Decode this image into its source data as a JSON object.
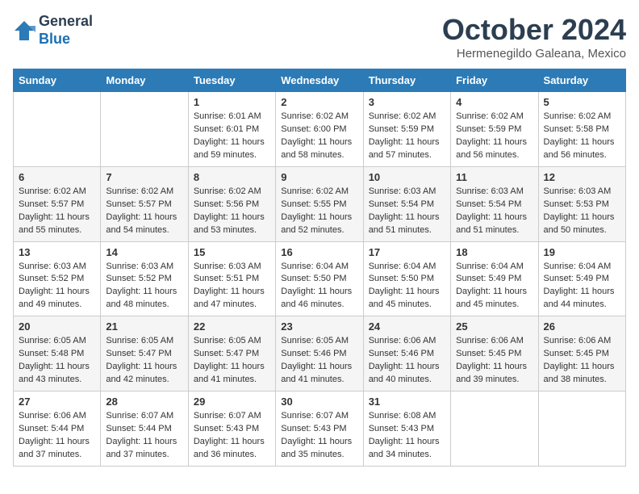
{
  "header": {
    "logo_line1": "General",
    "logo_line2": "Blue",
    "month_title": "October 2024",
    "location": "Hermenegildo Galeana, Mexico"
  },
  "weekdays": [
    "Sunday",
    "Monday",
    "Tuesday",
    "Wednesday",
    "Thursday",
    "Friday",
    "Saturday"
  ],
  "weeks": [
    [
      {
        "day": "",
        "content": ""
      },
      {
        "day": "",
        "content": ""
      },
      {
        "day": "1",
        "content": "Sunrise: 6:01 AM\nSunset: 6:01 PM\nDaylight: 11 hours and 59 minutes."
      },
      {
        "day": "2",
        "content": "Sunrise: 6:02 AM\nSunset: 6:00 PM\nDaylight: 11 hours and 58 minutes."
      },
      {
        "day": "3",
        "content": "Sunrise: 6:02 AM\nSunset: 5:59 PM\nDaylight: 11 hours and 57 minutes."
      },
      {
        "day": "4",
        "content": "Sunrise: 6:02 AM\nSunset: 5:59 PM\nDaylight: 11 hours and 56 minutes."
      },
      {
        "day": "5",
        "content": "Sunrise: 6:02 AM\nSunset: 5:58 PM\nDaylight: 11 hours and 56 minutes."
      }
    ],
    [
      {
        "day": "6",
        "content": "Sunrise: 6:02 AM\nSunset: 5:57 PM\nDaylight: 11 hours and 55 minutes."
      },
      {
        "day": "7",
        "content": "Sunrise: 6:02 AM\nSunset: 5:57 PM\nDaylight: 11 hours and 54 minutes."
      },
      {
        "day": "8",
        "content": "Sunrise: 6:02 AM\nSunset: 5:56 PM\nDaylight: 11 hours and 53 minutes."
      },
      {
        "day": "9",
        "content": "Sunrise: 6:02 AM\nSunset: 5:55 PM\nDaylight: 11 hours and 52 minutes."
      },
      {
        "day": "10",
        "content": "Sunrise: 6:03 AM\nSunset: 5:54 PM\nDaylight: 11 hours and 51 minutes."
      },
      {
        "day": "11",
        "content": "Sunrise: 6:03 AM\nSunset: 5:54 PM\nDaylight: 11 hours and 51 minutes."
      },
      {
        "day": "12",
        "content": "Sunrise: 6:03 AM\nSunset: 5:53 PM\nDaylight: 11 hours and 50 minutes."
      }
    ],
    [
      {
        "day": "13",
        "content": "Sunrise: 6:03 AM\nSunset: 5:52 PM\nDaylight: 11 hours and 49 minutes."
      },
      {
        "day": "14",
        "content": "Sunrise: 6:03 AM\nSunset: 5:52 PM\nDaylight: 11 hours and 48 minutes."
      },
      {
        "day": "15",
        "content": "Sunrise: 6:03 AM\nSunset: 5:51 PM\nDaylight: 11 hours and 47 minutes."
      },
      {
        "day": "16",
        "content": "Sunrise: 6:04 AM\nSunset: 5:50 PM\nDaylight: 11 hours and 46 minutes."
      },
      {
        "day": "17",
        "content": "Sunrise: 6:04 AM\nSunset: 5:50 PM\nDaylight: 11 hours and 45 minutes."
      },
      {
        "day": "18",
        "content": "Sunrise: 6:04 AM\nSunset: 5:49 PM\nDaylight: 11 hours and 45 minutes."
      },
      {
        "day": "19",
        "content": "Sunrise: 6:04 AM\nSunset: 5:49 PM\nDaylight: 11 hours and 44 minutes."
      }
    ],
    [
      {
        "day": "20",
        "content": "Sunrise: 6:05 AM\nSunset: 5:48 PM\nDaylight: 11 hours and 43 minutes."
      },
      {
        "day": "21",
        "content": "Sunrise: 6:05 AM\nSunset: 5:47 PM\nDaylight: 11 hours and 42 minutes."
      },
      {
        "day": "22",
        "content": "Sunrise: 6:05 AM\nSunset: 5:47 PM\nDaylight: 11 hours and 41 minutes."
      },
      {
        "day": "23",
        "content": "Sunrise: 6:05 AM\nSunset: 5:46 PM\nDaylight: 11 hours and 41 minutes."
      },
      {
        "day": "24",
        "content": "Sunrise: 6:06 AM\nSunset: 5:46 PM\nDaylight: 11 hours and 40 minutes."
      },
      {
        "day": "25",
        "content": "Sunrise: 6:06 AM\nSunset: 5:45 PM\nDaylight: 11 hours and 39 minutes."
      },
      {
        "day": "26",
        "content": "Sunrise: 6:06 AM\nSunset: 5:45 PM\nDaylight: 11 hours and 38 minutes."
      }
    ],
    [
      {
        "day": "27",
        "content": "Sunrise: 6:06 AM\nSunset: 5:44 PM\nDaylight: 11 hours and 37 minutes."
      },
      {
        "day": "28",
        "content": "Sunrise: 6:07 AM\nSunset: 5:44 PM\nDaylight: 11 hours and 37 minutes."
      },
      {
        "day": "29",
        "content": "Sunrise: 6:07 AM\nSunset: 5:43 PM\nDaylight: 11 hours and 36 minutes."
      },
      {
        "day": "30",
        "content": "Sunrise: 6:07 AM\nSunset: 5:43 PM\nDaylight: 11 hours and 35 minutes."
      },
      {
        "day": "31",
        "content": "Sunrise: 6:08 AM\nSunset: 5:43 PM\nDaylight: 11 hours and 34 minutes."
      },
      {
        "day": "",
        "content": ""
      },
      {
        "day": "",
        "content": ""
      }
    ]
  ]
}
